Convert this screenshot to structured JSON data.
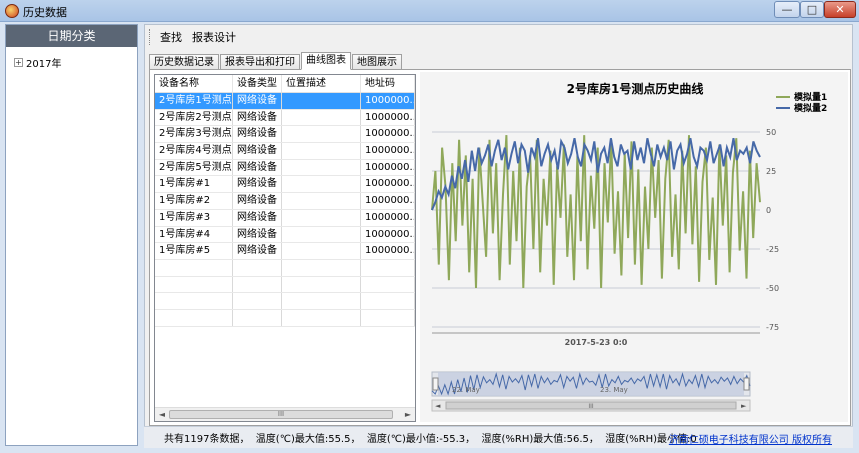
{
  "window": {
    "title": "历史数据",
    "min_label": "—",
    "max_label": "□",
    "close_label": "✕"
  },
  "sidebar": {
    "header": "日期分类",
    "tree_items": [
      {
        "toggle": "+",
        "label": "2017年"
      }
    ]
  },
  "toolbar": {
    "items": [
      "查找",
      "报表设计"
    ]
  },
  "tabs": [
    "历史数据记录",
    "报表导出和打印",
    "曲线图表",
    "地图展示"
  ],
  "table": {
    "columns": [
      "设备名称",
      "设备类型",
      "位置描述",
      "地址码"
    ],
    "rows": [
      [
        "2号库房1号测点",
        "网络设备",
        "",
        "1000000..."
      ],
      [
        "2号库房2号测点",
        "网络设备",
        "",
        "1000000..."
      ],
      [
        "2号库房3号测点",
        "网络设备",
        "",
        "1000000..."
      ],
      [
        "2号库房4号测点",
        "网络设备",
        "",
        "1000000..."
      ],
      [
        "2号库房5号测点",
        "网络设备",
        "",
        "1000000..."
      ],
      [
        "1号库房#1",
        "网络设备",
        "",
        "1000000..."
      ],
      [
        "1号库房#2",
        "网络设备",
        "",
        "1000000..."
      ],
      [
        "1号库房#3",
        "网络设备",
        "",
        "1000000..."
      ],
      [
        "1号库房#4",
        "网络设备",
        "",
        "1000000..."
      ],
      [
        "1号库房#5",
        "网络设备",
        "",
        "1000000..."
      ]
    ],
    "selected_row": 0,
    "scroll_left": "◄",
    "scroll_right": "►",
    "scroll_thumb": "III"
  },
  "chart_data": {
    "type": "line",
    "title": "2号库房1号测点历史曲线",
    "xlabel": "2017-5-23 0:0",
    "ylabel": "",
    "ylim": [
      -75,
      50
    ],
    "yticks": [
      "50",
      "25",
      "0",
      "-25",
      "-50",
      "-75"
    ],
    "yticks_values": [
      50,
      25,
      0,
      -25,
      -50,
      -75
    ],
    "grid": true,
    "legend_position": "top-right",
    "navigator_labels": [
      "22. May",
      "23. May"
    ],
    "navigator_scroll_thumb": "III",
    "navigator_arrow_left": "◄",
    "navigator_arrow_right": "►",
    "series": [
      {
        "name": "模拟量1",
        "color": "#8fa85a",
        "values": [
          0,
          25,
          -35,
          40,
          15,
          -45,
          30,
          -20,
          45,
          -10,
          35,
          -40,
          20,
          -50,
          40,
          5,
          -30,
          45,
          -15,
          30,
          -45,
          10,
          48,
          -35,
          25,
          -20,
          40,
          -50,
          15,
          35,
          -25,
          45,
          -40,
          20,
          -10,
          38,
          -48,
          28,
          -5,
          42,
          -30,
          10,
          -45,
          35,
          -20,
          48,
          -38,
          22,
          -12,
          40,
          -50,
          30,
          -8,
          45,
          -28,
          12,
          -42,
          36,
          -18,
          44,
          -35,
          26,
          -48,
          15,
          -25,
          40,
          -5,
          32,
          -44,
          20,
          45,
          -30,
          10,
          -38,
          38,
          -15,
          48,
          -22,
          28,
          -46,
          18,
          40,
          -32,
          8,
          -48,
          42,
          -10,
          35,
          -40,
          24,
          46,
          -26,
          12,
          -44,
          38,
          -18,
          30,
          5
        ]
      },
      {
        "name": "模拟量2",
        "color": "#4669a8",
        "values": [
          0,
          5,
          12,
          8,
          15,
          10,
          22,
          14,
          28,
          20,
          32,
          18,
          38,
          25,
          40,
          30,
          35,
          42,
          28,
          38,
          45,
          32,
          40,
          26,
          36,
          44,
          30,
          42,
          38,
          24,
          40,
          34,
          46,
          28,
          36,
          42,
          32,
          38,
          26,
          44,
          40,
          30,
          36,
          46,
          34,
          28,
          42,
          38,
          32,
          44,
          24,
          36,
          40,
          30,
          46,
          34,
          28,
          42,
          36,
          38,
          26,
          44,
          32,
          40,
          30,
          46,
          36,
          28,
          42,
          34,
          40,
          32,
          44,
          26,
          38,
          42,
          30,
          36,
          46,
          34,
          28,
          40,
          38,
          32,
          44,
          30,
          36,
          42,
          28,
          40,
          34,
          46,
          32,
          38,
          36,
          40,
          30,
          44,
          38,
          34
        ]
      }
    ]
  },
  "status": {
    "text": "共有1197条数据，  温度(℃)最大值:55.5，  温度(℃)最小值:-55.3，  湿度(%RH)最大值:56.5，  湿度(%RH)最小值:0",
    "link": "济南仁硕电子科技有限公司 版权所有"
  },
  "colors": {
    "selection": "#3399ff",
    "series1": "#8fa85a",
    "series2": "#4669a8",
    "link": "#0033cc"
  }
}
